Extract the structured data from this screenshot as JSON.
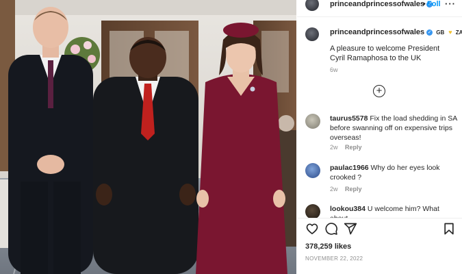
{
  "post": {
    "username": "princeandprincessofwales",
    "verified_mark": "✓",
    "dot": "•",
    "follow_label": "Foll",
    "more_label": "···"
  },
  "caption": {
    "username": "princeandprincessofwales",
    "flag1": "GB",
    "flag2": "ZA",
    "text": "A pleasure to welcome President Cyril Ramaphosa to the UK",
    "time": "6w"
  },
  "load_more_label": "+",
  "comments": [
    {
      "username": "taurus5578",
      "text": "Fix the load shedding in SA before swanning off on expensive trips overseas!",
      "time": "2w",
      "reply": "Reply"
    },
    {
      "username": "paulac1966",
      "text": "Why do her eyes look crooked ?",
      "time": "2w",
      "reply": "Reply"
    },
    {
      "username": "lookou384",
      "text": "U welcome him? What about"
    }
  ],
  "likes": "378,259 likes",
  "date": "NOVEMBER 22, 2022",
  "icons": {
    "like": "heart-icon",
    "comment": "comment-icon",
    "share": "share-icon",
    "save": "bookmark-icon"
  },
  "colors": {
    "accent": "#0095f6",
    "verified": "#3897f0",
    "muted": "#8e8e8e",
    "dress": "#7a1630"
  }
}
